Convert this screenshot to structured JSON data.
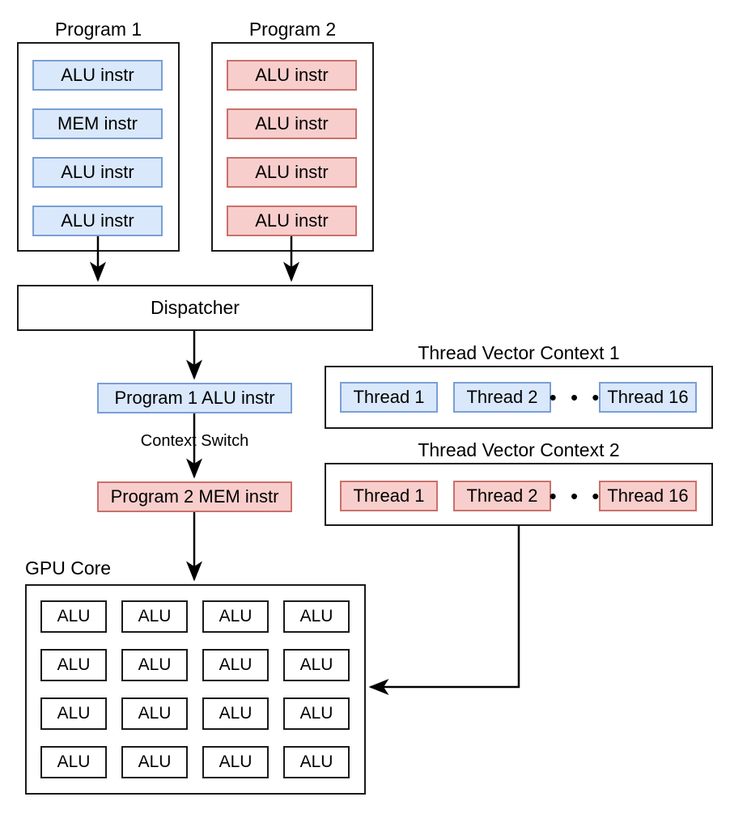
{
  "diagram": {
    "title": "GPU context switching and thread vector contexts",
    "colors": {
      "blue_fill": "#dae8fc",
      "blue_stroke": "#7a9fd4",
      "red_fill": "#f8cecc",
      "red_stroke": "#c9716b",
      "box_stroke": "#1a1a1a",
      "background": "#ffffff"
    }
  },
  "program1": {
    "caption": "Program 1",
    "instructions": [
      {
        "label": "ALU instr"
      },
      {
        "label": "MEM instr"
      },
      {
        "label": "ALU instr"
      },
      {
        "label": "ALU instr"
      }
    ]
  },
  "program2": {
    "caption": "Program 2",
    "instructions": [
      {
        "label": "ALU instr"
      },
      {
        "label": "ALU instr"
      },
      {
        "label": "ALU instr"
      },
      {
        "label": "ALU instr"
      }
    ]
  },
  "dispatcher": {
    "label": "Dispatcher"
  },
  "pipeline": {
    "issued_instr_1": "Program 1 ALU instr",
    "context_switch_label": "Context Switch",
    "issued_instr_2": "Program 2 MEM instr"
  },
  "thread_vector_context_1": {
    "caption": "Thread Vector Context 1",
    "threads": [
      {
        "label": "Thread 1"
      },
      {
        "label": "Thread 2"
      },
      {
        "label": "Thread 16"
      }
    ],
    "ellipsis": "• • •"
  },
  "thread_vector_context_2": {
    "caption": "Thread Vector Context 2",
    "threads": [
      {
        "label": "Thread 1"
      },
      {
        "label": "Thread 2"
      },
      {
        "label": "Thread 16"
      }
    ],
    "ellipsis": "• • •"
  },
  "gpu_core": {
    "caption": "GPU Core",
    "rows": 4,
    "cols": 4,
    "cells": [
      [
        "ALU",
        "ALU",
        "ALU",
        "ALU"
      ],
      [
        "ALU",
        "ALU",
        "ALU",
        "ALU"
      ],
      [
        "ALU",
        "ALU",
        "ALU",
        "ALU"
      ],
      [
        "ALU",
        "ALU",
        "ALU",
        "ALU"
      ]
    ]
  }
}
